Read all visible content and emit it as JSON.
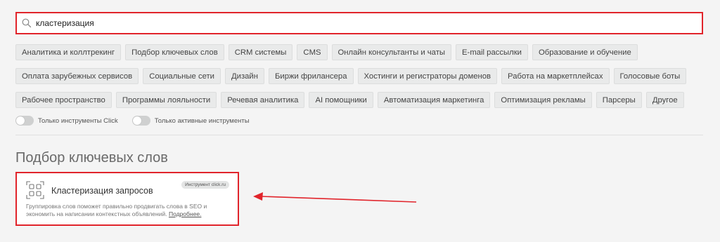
{
  "search": {
    "value": "кластеризация",
    "icon": "search-icon",
    "border_color": "#e1242b"
  },
  "categories": {
    "row1": [
      "Аналитика и коллтрекинг",
      "Подбор ключевых слов",
      "CRM системы",
      "CMS",
      "Онлайн консультанты и чаты",
      "E-mail рассылки",
      "Образование и обучение"
    ],
    "row2": [
      "Оплата зарубежных сервисов",
      "Социальные сети",
      "Дизайн",
      "Биржи фрилансера",
      "Хостинги и регистраторы доменов",
      "Работа на маркетплейсах",
      "Голосовые боты"
    ],
    "row3": [
      "Рабочее пространство",
      "Программы лояльности",
      "Речевая аналитика",
      "AI помощники",
      "Автоматизация маркетинга",
      "Оптимизация рекламы",
      "Парсеры",
      "Другое"
    ]
  },
  "filters": {
    "only_click": "Только инструменты Click",
    "only_active": "Только активные инструменты"
  },
  "section": {
    "title": "Подбор ключевых слов"
  },
  "card": {
    "title": "Кластеризация запросов",
    "badge": "Инструмент click.ru",
    "description": "Группировка слов поможет правильно продвигать слова в SEO и экономить на написании контекстных объявлений.",
    "more": "Подробнее.",
    "icon": "cluster-icon"
  },
  "annotation": {
    "arrow_color": "#e1242b"
  }
}
